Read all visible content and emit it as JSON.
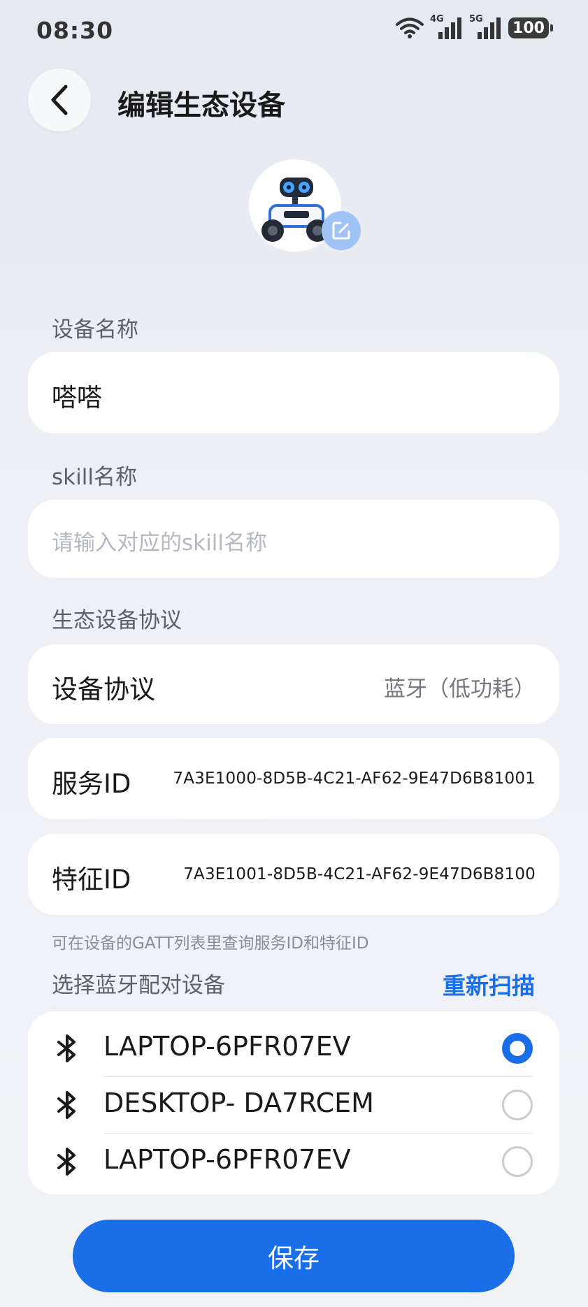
{
  "status_bar": {
    "time": "08:30",
    "signal1_label": "4G",
    "signal2_label": "5G",
    "battery": "100"
  },
  "header": {
    "title": "编辑生态设备"
  },
  "device_name": {
    "label": "设备名称",
    "value": "嗒嗒"
  },
  "skill_name": {
    "label": "skill名称",
    "placeholder": "请输入对应的skill名称"
  },
  "protocol_section": {
    "label": "生态设备协议",
    "protocol": {
      "label": "设备协议",
      "value": "蓝牙（低功耗）"
    },
    "service_id": {
      "label": "服务ID",
      "value": "7A3E1000-8D5B-4C21-AF62-9E47D6B81001"
    },
    "char_id": {
      "label": "特征ID",
      "value": "7A3E1001-8D5B-4C21-AF62-9E47D6B8100"
    },
    "hint": "可在设备的GATT列表里查询服务ID和特征ID"
  },
  "bluetooth": {
    "label": "选择蓝牙配对设备",
    "rescan": "重新扫描",
    "devices": [
      {
        "name": "LAPTOP-6PFR07EV",
        "selected": true
      },
      {
        "name": "DESKTOP- DA7RCEM",
        "selected": false
      },
      {
        "name": "LAPTOP-6PFR07EV",
        "selected": false
      }
    ]
  },
  "save_label": "保存",
  "colors": {
    "accent": "#1a6fe8",
    "edit_badge": "#9fc3f5"
  },
  "icons": [
    "wifi-icon",
    "signal-icon",
    "battery-icon",
    "back-arrow-icon",
    "edit-icon",
    "bluetooth-icon"
  ]
}
